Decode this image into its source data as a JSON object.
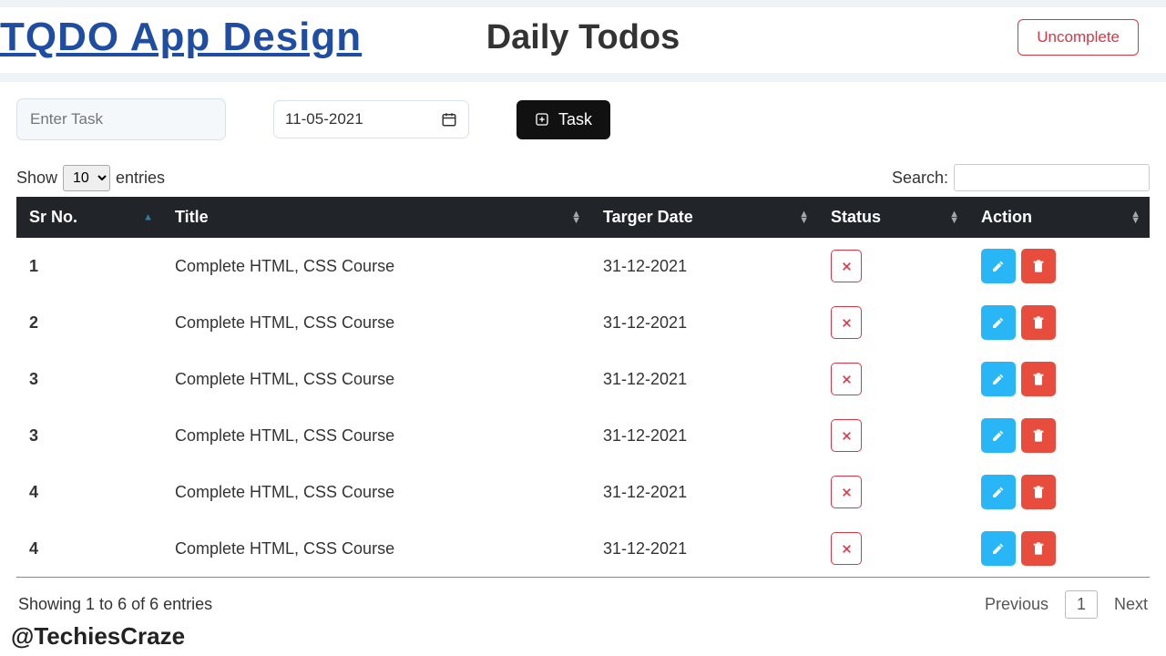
{
  "header": {
    "app_title": "TQDO App Design",
    "page_title": "Daily Todos",
    "uncomplete_btn": "Uncomplete"
  },
  "form": {
    "task_placeholder": "Enter Task",
    "date_value": "11-05-2021",
    "add_btn_label": "Task"
  },
  "table_controls": {
    "show_label": "Show",
    "entries_label": "entries",
    "page_size": "10",
    "search_label": "Search:"
  },
  "columns": {
    "srno": "Sr No.",
    "title": "Title",
    "target_date": "Targer Date",
    "status": "Status",
    "action": "Action"
  },
  "rows": [
    {
      "srno": "1",
      "title": "Complete HTML, CSS Course",
      "date": "31-12-2021"
    },
    {
      "srno": "2",
      "title": "Complete HTML, CSS Course",
      "date": "31-12-2021"
    },
    {
      "srno": "3",
      "title": "Complete HTML, CSS Course",
      "date": "31-12-2021"
    },
    {
      "srno": "3",
      "title": "Complete HTML, CSS Course",
      "date": "31-12-2021"
    },
    {
      "srno": "4",
      "title": "Complete HTML, CSS Course",
      "date": "31-12-2021"
    },
    {
      "srno": "4",
      "title": "Complete HTML, CSS Course",
      "date": "31-12-2021"
    }
  ],
  "footer": {
    "info": "Showing 1 to 6 of 6 entries",
    "prev": "Previous",
    "page": "1",
    "next": "Next"
  },
  "watermark": "@TechiesCraze"
}
